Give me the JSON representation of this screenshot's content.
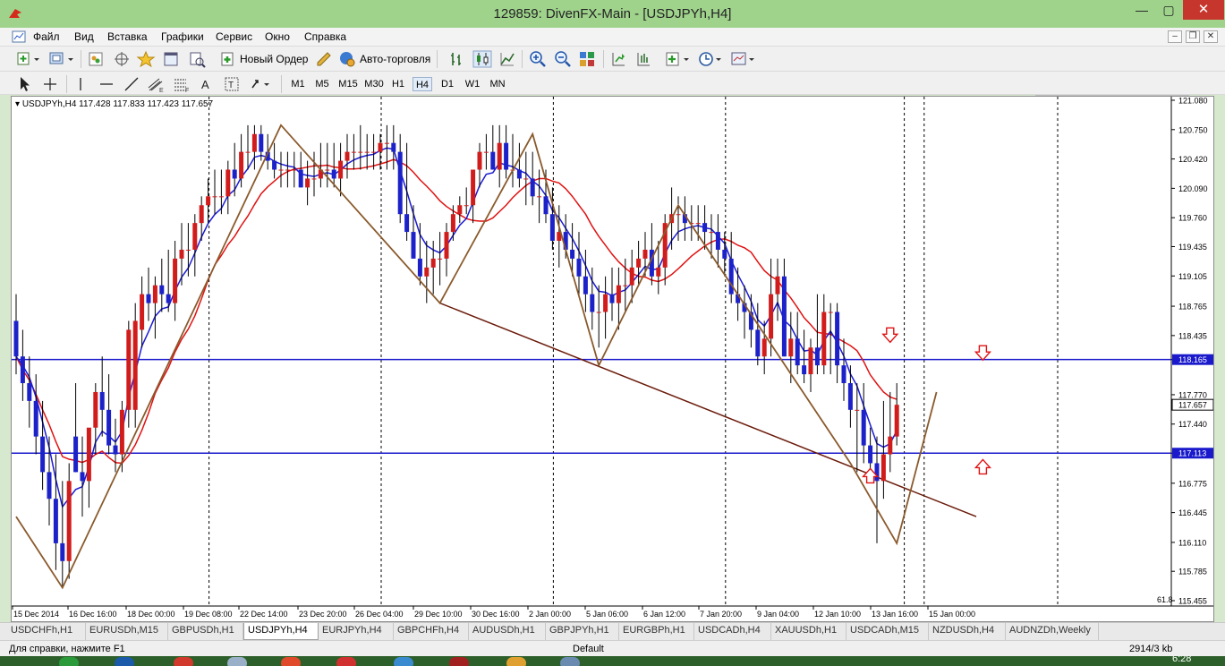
{
  "window": {
    "title": "129859: DivenFX-Main - [USDJPYh,H4]",
    "min": "—",
    "max": "▢",
    "close": "✕"
  },
  "menu": {
    "items": [
      "Файл",
      "Вид",
      "Вставка",
      "Графики",
      "Сервис",
      "Окно",
      "Справка"
    ]
  },
  "toolbar": {
    "new_order": "Новый Ордер",
    "auto_trading": "Авто-торговля"
  },
  "timeframes": [
    "M1",
    "M5",
    "M15",
    "M30",
    "H1",
    "H4",
    "D1",
    "W1",
    "MN"
  ],
  "active_timeframe": "H4",
  "chart": {
    "header": "USDJPYh,H4  117.428 117.833 117.423 117.657",
    "price_labels": [
      "121.080",
      "120.750",
      "120.420",
      "120.090",
      "119.760",
      "119.435",
      "119.105",
      "118.765",
      "118.435",
      "118.165",
      "117.770",
      "117.657",
      "117.440",
      "117.113",
      "116.775",
      "116.445",
      "116.110",
      "115.785",
      "115.455"
    ],
    "level_labels": {
      "upper": "118.165",
      "lower": "117.113",
      "current": "117.657"
    },
    "fib_label": "61.8",
    "date_labels": [
      "15 Dec 2014",
      "16 Dec 16:00",
      "18 Dec 00:00",
      "19 Dec 08:00",
      "22 Dec 14:00",
      "23 Dec 20:00",
      "26 Dec 04:00",
      "29 Dec 10:00",
      "30 Dec 16:00",
      "2 Jan 00:00",
      "5 Jan 06:00",
      "6 Jan 12:00",
      "7 Jan 20:00",
      "9 Jan 04:00",
      "12 Jan 10:00",
      "13 Jan 16:00",
      "15 Jan 00:00"
    ]
  },
  "chart_data": {
    "type": "candlestick",
    "symbol": "USDJPYh",
    "timeframe": "H4",
    "ylim": [
      115.455,
      121.08
    ],
    "bull_color": "#d11c1c",
    "bear_color": "#1c22c8",
    "ma_fast_color": "#1b1bd4",
    "ma_slow_color": "#e01212",
    "zigzag_color": "#8a5a2c",
    "trendline_color": "#6b1a0a",
    "level_color": "#1a1acc",
    "arrow_color": "#e01212",
    "horizontal_levels": [
      118.165,
      117.113
    ],
    "current_price": 117.657,
    "ohlc": {
      "open": [
        118.6,
        118.2,
        117.9,
        117.7,
        117.3,
        116.9,
        116.6,
        116.1,
        115.9,
        117.3,
        116.9,
        116.8,
        117.4,
        117.8,
        117.6,
        117.2,
        117.1,
        117.6,
        117.6,
        118.5,
        118.9,
        118.8,
        119.0,
        118.9,
        118.8,
        119.3,
        119.4,
        119.4,
        119.7,
        119.9,
        120.0,
        120.0,
        120.0,
        120.3,
        120.2,
        120.5,
        120.5,
        120.7,
        120.5,
        120.4,
        120.3,
        120.3,
        120.3,
        120.3,
        120.1,
        120.2,
        120.2,
        120.3,
        120.3,
        120.2,
        120.4,
        120.5,
        120.5,
        120.5,
        120.5,
        120.5,
        120.6,
        120.6,
        120.5,
        119.8,
        119.6,
        119.3,
        119.1,
        119.2,
        119.3,
        119.3,
        119.6,
        119.8,
        119.9,
        119.9,
        120.3,
        120.5,
        120.5,
        120.3,
        120.6,
        120.3,
        120.3,
        120.2,
        120.2,
        120.0,
        120.0,
        119.8,
        119.5,
        119.6,
        119.4,
        119.3,
        119.1,
        118.9,
        118.7,
        118.7,
        118.9,
        118.8,
        119.0,
        119.0,
        119.2,
        119.3,
        119.4,
        119.1,
        119.2,
        119.7,
        119.8,
        119.8,
        119.7,
        119.7,
        119.7,
        119.6,
        119.6,
        119.4,
        119.3,
        118.9,
        118.8,
        118.7,
        118.5,
        118.2,
        118.4,
        118.9,
        119.1,
        118.2,
        118.4,
        118.1,
        118.0,
        118.3,
        118.1,
        118.7,
        118.7,
        118.1,
        117.9,
        117.6,
        117.6,
        117.2,
        117.0,
        116.8,
        117.1,
        117.3
      ],
      "high": [
        118.9,
        118.5,
        118.2,
        118.0,
        117.7,
        117.3,
        117.1,
        116.8,
        117.0,
        117.9,
        117.3,
        117.3,
        117.9,
        118.2,
        118.0,
        117.5,
        117.7,
        118.6,
        118.8,
        119.1,
        119.2,
        119.1,
        119.3,
        119.4,
        119.5,
        119.7,
        119.7,
        119.8,
        120.0,
        120.2,
        120.3,
        120.3,
        120.4,
        120.6,
        120.7,
        120.8,
        120.8,
        120.8,
        120.7,
        120.6,
        120.5,
        120.5,
        120.5,
        120.5,
        120.4,
        120.5,
        120.6,
        120.6,
        120.6,
        120.6,
        120.7,
        120.7,
        120.8,
        120.7,
        120.7,
        120.7,
        120.8,
        120.8,
        120.7,
        120.6,
        119.9,
        119.7,
        119.5,
        119.5,
        119.6,
        119.7,
        119.9,
        120.0,
        120.1,
        120.2,
        120.6,
        120.7,
        120.8,
        120.8,
        120.8,
        120.7,
        120.6,
        120.5,
        120.5,
        120.3,
        120.3,
        120.1,
        119.9,
        119.8,
        119.7,
        119.6,
        119.4,
        119.2,
        119.0,
        119.1,
        119.2,
        119.2,
        119.3,
        119.4,
        119.5,
        119.6,
        119.7,
        119.5,
        119.8,
        120.1,
        120.0,
        120.0,
        119.9,
        119.9,
        119.9,
        119.8,
        119.8,
        119.6,
        119.6,
        119.2,
        119.0,
        118.9,
        118.8,
        118.6,
        119.3,
        119.3,
        119.3,
        118.7,
        118.7,
        118.5,
        118.4,
        118.9,
        118.9,
        118.8,
        118.8,
        118.4,
        118.1,
        117.9,
        117.9,
        117.4,
        117.3,
        117.7,
        117.8,
        117.9
      ],
      "low": [
        118.0,
        117.7,
        117.4,
        117.1,
        116.7,
        116.3,
        115.8,
        115.6,
        115.7,
        116.9,
        116.4,
        116.5,
        117.1,
        117.3,
        117.1,
        116.9,
        116.9,
        117.4,
        117.4,
        118.3,
        118.6,
        118.4,
        118.7,
        118.7,
        118.6,
        119.0,
        119.1,
        119.1,
        119.5,
        119.7,
        119.8,
        119.8,
        119.8,
        120.0,
        120.1,
        120.3,
        120.3,
        120.4,
        120.3,
        120.2,
        120.1,
        120.1,
        120.1,
        120.1,
        119.9,
        120.0,
        120.1,
        120.1,
        120.1,
        120.0,
        120.2,
        120.3,
        120.3,
        120.3,
        120.3,
        120.3,
        120.3,
        120.3,
        119.7,
        119.5,
        119.3,
        119.0,
        118.8,
        118.9,
        119.0,
        119.1,
        119.5,
        119.7,
        119.8,
        119.7,
        120.1,
        120.3,
        120.3,
        120.1,
        120.2,
        120.1,
        120.1,
        119.9,
        119.9,
        119.7,
        119.7,
        119.4,
        119.2,
        119.3,
        119.1,
        118.9,
        118.7,
        118.5,
        118.3,
        118.4,
        118.6,
        118.5,
        118.7,
        118.8,
        119.0,
        119.1,
        119.0,
        118.9,
        119.0,
        119.4,
        119.5,
        119.5,
        119.5,
        119.5,
        119.4,
        119.3,
        119.2,
        119.1,
        118.8,
        118.6,
        118.4,
        118.3,
        118.1,
        118.0,
        118.2,
        118.6,
        118.2,
        117.9,
        118.0,
        117.9,
        117.8,
        118.0,
        118.0,
        118.0,
        117.9,
        117.7,
        117.4,
        116.9,
        117.0,
        116.8,
        116.1,
        116.6,
        116.9,
        117.2
      ],
      "close": [
        118.2,
        117.9,
        117.7,
        117.3,
        116.9,
        116.6,
        116.1,
        115.9,
        116.8,
        116.9,
        116.8,
        117.4,
        117.8,
        117.6,
        117.2,
        117.1,
        117.6,
        118.5,
        118.6,
        118.9,
        118.8,
        119.0,
        118.9,
        118.8,
        119.3,
        119.4,
        119.4,
        119.7,
        119.9,
        120.0,
        120.0,
        120.0,
        120.3,
        120.2,
        120.5,
        120.5,
        120.7,
        120.5,
        120.4,
        120.3,
        120.3,
        120.3,
        120.3,
        120.1,
        120.2,
        120.2,
        120.3,
        120.3,
        120.2,
        120.4,
        120.5,
        120.5,
        120.5,
        120.5,
        120.5,
        120.6,
        120.6,
        120.5,
        119.8,
        119.6,
        119.3,
        119.1,
        119.2,
        119.3,
        119.3,
        119.6,
        119.8,
        119.9,
        119.9,
        120.3,
        120.5,
        120.5,
        120.3,
        120.6,
        120.3,
        120.3,
        120.2,
        120.2,
        120.0,
        120.0,
        119.8,
        119.5,
        119.6,
        119.4,
        119.3,
        119.1,
        118.9,
        118.7,
        118.7,
        118.9,
        118.8,
        119.0,
        119.0,
        119.2,
        119.3,
        119.4,
        119.1,
        119.2,
        119.7,
        119.8,
        119.8,
        119.7,
        119.7,
        119.7,
        119.6,
        119.6,
        119.4,
        119.3,
        118.9,
        118.8,
        118.7,
        118.5,
        118.2,
        118.4,
        118.9,
        119.1,
        118.2,
        118.4,
        118.1,
        118.0,
        118.3,
        118.1,
        118.7,
        118.7,
        118.1,
        117.9,
        117.6,
        117.6,
        117.2,
        117.0,
        116.8,
        117.1,
        117.3,
        117.657
      ]
    },
    "zigzag": [
      [
        0,
        116.4
      ],
      [
        7,
        115.6
      ],
      [
        40,
        120.8
      ],
      [
        64,
        118.8
      ],
      [
        78,
        120.7
      ],
      [
        88,
        118.1
      ],
      [
        100,
        119.9
      ],
      [
        126,
        117.0
      ],
      [
        133,
        116.1
      ],
      [
        139,
        117.8
      ]
    ],
    "trendline": [
      [
        64,
        118.8
      ],
      [
        145,
        116.4
      ]
    ],
    "arrows_down": [
      [
        132,
        118.4
      ],
      [
        146,
        118.2
      ]
    ],
    "arrows_up": [
      [
        129,
        116.9
      ],
      [
        146,
        117.0
      ]
    ],
    "date_separators": [
      29,
      55,
      81,
      107,
      134,
      137
    ]
  },
  "tabs": [
    "USDCHFh,H1",
    "EURUSDh,M15",
    "GBPUSDh,H1",
    "USDJPYh,H4",
    "EURJPYh,H4",
    "GBPCHFh,H4",
    "AUDUSDh,H1",
    "GBPJPYh,H1",
    "EURGBPh,H1",
    "USDCADh,H4",
    "XAUUSDh,H1",
    "USDCADh,M15",
    "NZDUSDh,H4",
    "AUDNZDh,Weekly"
  ],
  "active_tab": "USDJPYh,H4",
  "status": {
    "help": "Для справки, нажмите F1",
    "profile": "Default",
    "traffic": "2914/3 kb"
  },
  "taskbar": {
    "clock": "6:28"
  }
}
